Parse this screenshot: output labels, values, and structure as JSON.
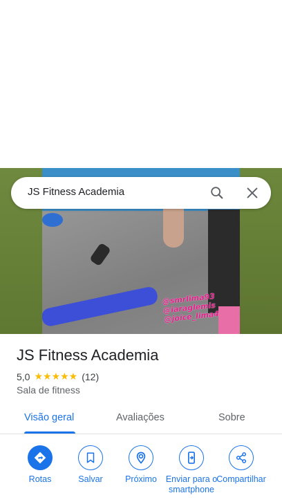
{
  "search": {
    "query": "JS Fitness Academia"
  },
  "photo": {
    "watermark": [
      "@smrlima93",
      "@iaraglemis",
      "@joice_lima4"
    ]
  },
  "place": {
    "title": "JS Fitness Academia",
    "rating": "5,0",
    "stars": "★★★★★",
    "reviews": "(12)",
    "category": "Sala de fitness"
  },
  "tabs": [
    {
      "label": "Visão geral",
      "active": true
    },
    {
      "label": "Avaliações",
      "active": false
    },
    {
      "label": "Sobre",
      "active": false
    }
  ],
  "actions": [
    {
      "label": "Rotas",
      "icon": "directions-icon"
    },
    {
      "label": "Salvar",
      "icon": "bookmark-icon"
    },
    {
      "label": "Próximo",
      "icon": "nearby-icon"
    },
    {
      "label": "Enviar para o smartphone",
      "icon": "send-to-phone-icon"
    },
    {
      "label": "Compartilhar",
      "icon": "share-icon"
    }
  ],
  "colors": {
    "accent": "#1a73e8",
    "star": "#fbbc04",
    "watermark": "#e0218a"
  }
}
